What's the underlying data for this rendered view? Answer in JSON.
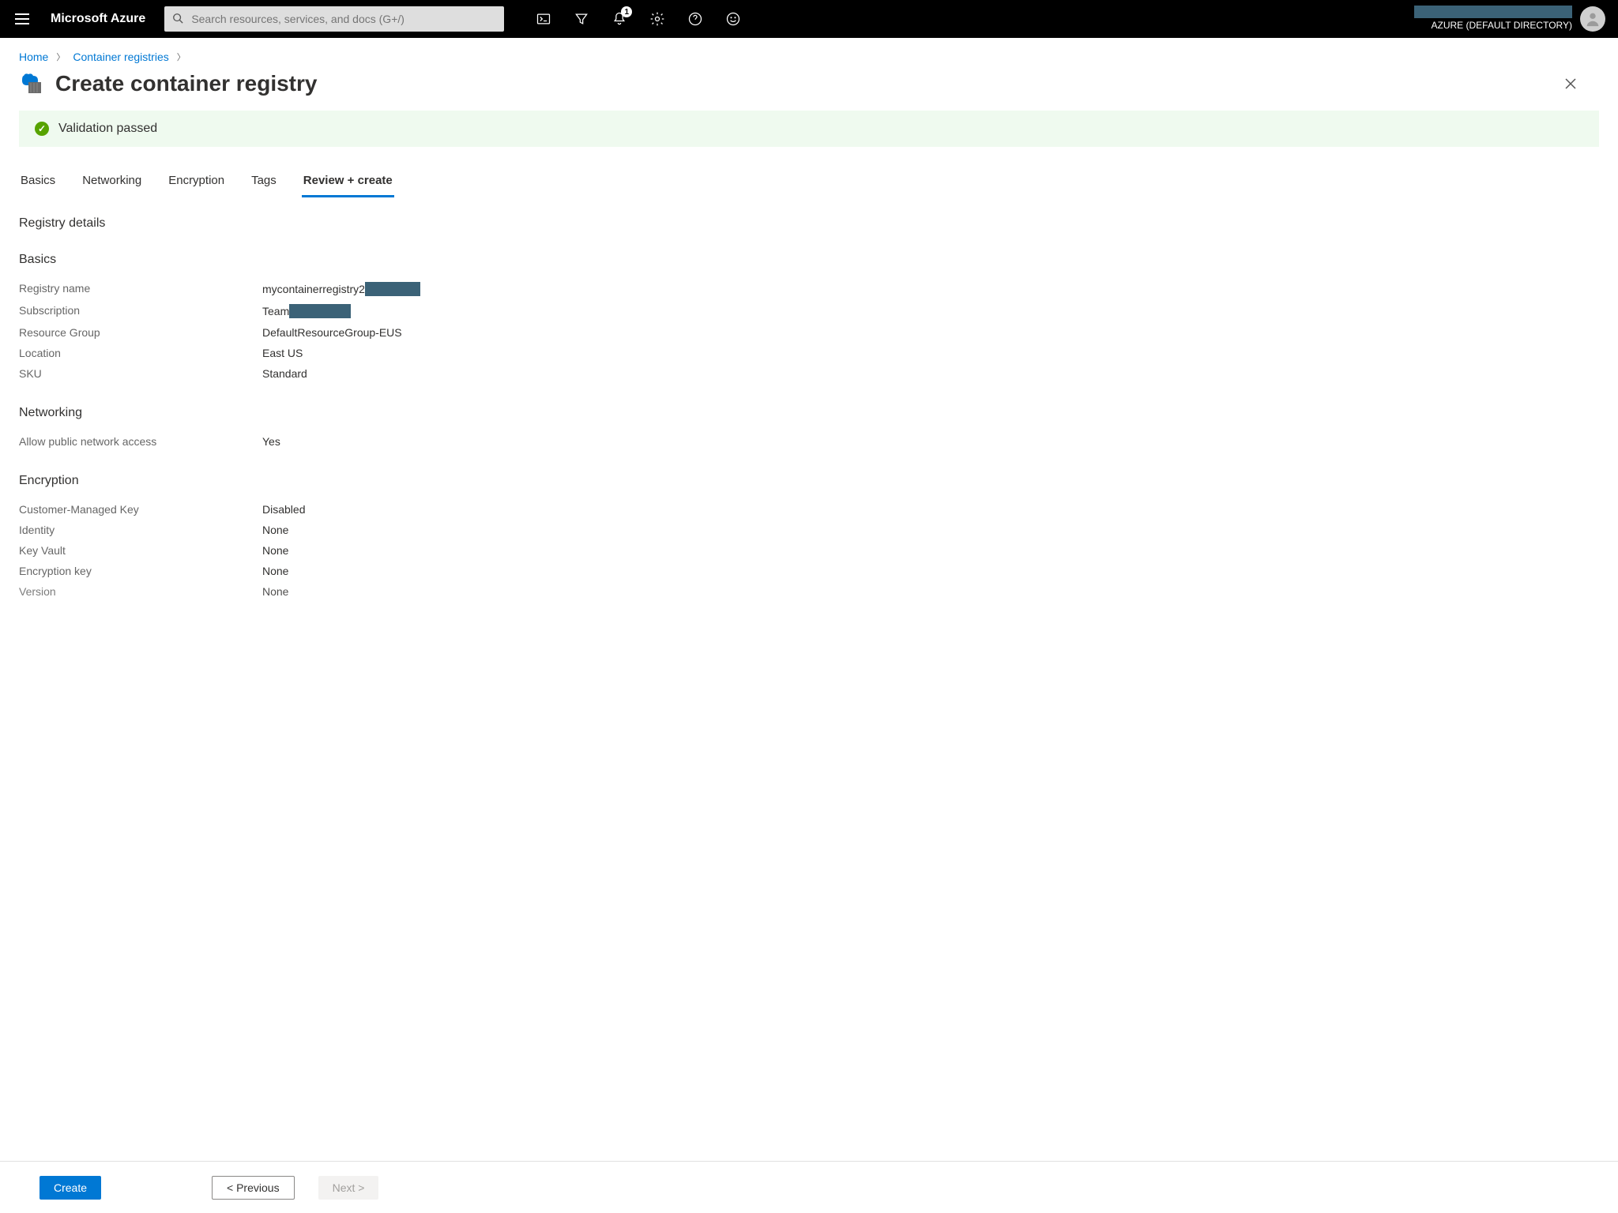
{
  "header": {
    "brand": "Microsoft Azure",
    "search_placeholder": "Search resources, services, and docs (G+/)",
    "notification_count": "1",
    "directory": "AZURE (DEFAULT DIRECTORY)"
  },
  "breadcrumb": {
    "home": "Home",
    "cr": "Container registries"
  },
  "page": {
    "title": "Create container registry",
    "validation": "Validation passed"
  },
  "tabs": {
    "basics": "Basics",
    "networking": "Networking",
    "encryption": "Encryption",
    "tags": "Tags",
    "review": "Review + create"
  },
  "sections": {
    "registry_details": "Registry details",
    "basics": "Basics",
    "networking": "Networking",
    "encryption": "Encryption"
  },
  "basics": {
    "registry_name_label": "Registry name",
    "registry_name_value": "mycontainerregistry2",
    "subscription_label": "Subscription",
    "subscription_value": "Team ",
    "rg_label": "Resource Group",
    "rg_value": "DefaultResourceGroup-EUS",
    "location_label": "Location",
    "location_value": "East US",
    "sku_label": "SKU",
    "sku_value": "Standard"
  },
  "networking": {
    "public_label": "Allow public network access",
    "public_value": "Yes"
  },
  "encryption": {
    "cmk_label": "Customer-Managed Key",
    "cmk_value": "Disabled",
    "identity_label": "Identity",
    "identity_value": "None",
    "kv_label": "Key Vault",
    "kv_value": "None",
    "key_label": "Encryption key",
    "key_value": "None",
    "version_label": "Version",
    "version_value": "None"
  },
  "footer": {
    "create": "Create",
    "previous": "< Previous",
    "next": "Next >"
  }
}
